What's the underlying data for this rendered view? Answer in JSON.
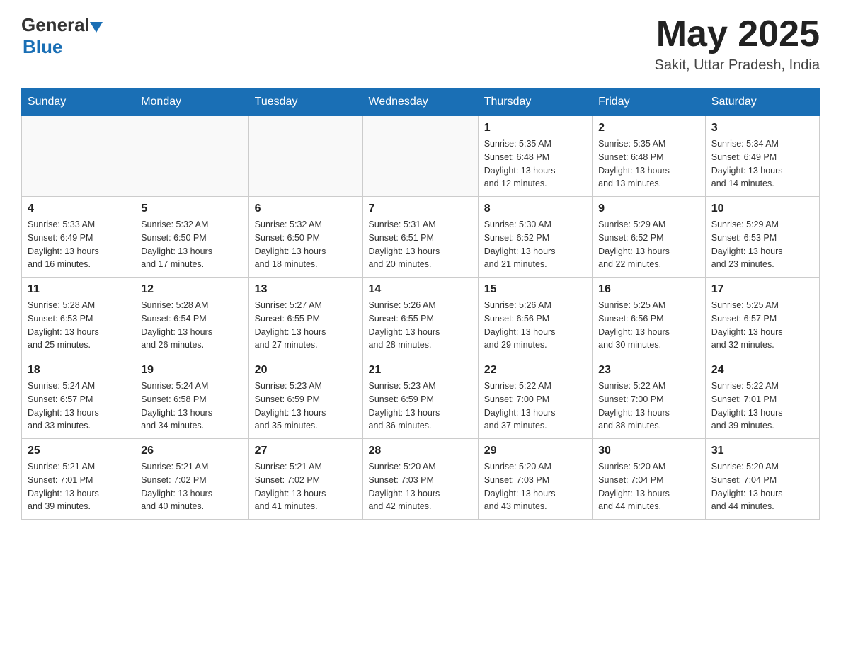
{
  "header": {
    "logo_general": "General",
    "logo_blue": "Blue",
    "month_year": "May 2025",
    "location": "Sakit, Uttar Pradesh, India"
  },
  "weekdays": [
    "Sunday",
    "Monday",
    "Tuesday",
    "Wednesday",
    "Thursday",
    "Friday",
    "Saturday"
  ],
  "weeks": [
    [
      {
        "day": "",
        "info": ""
      },
      {
        "day": "",
        "info": ""
      },
      {
        "day": "",
        "info": ""
      },
      {
        "day": "",
        "info": ""
      },
      {
        "day": "1",
        "info": "Sunrise: 5:35 AM\nSunset: 6:48 PM\nDaylight: 13 hours\nand 12 minutes."
      },
      {
        "day": "2",
        "info": "Sunrise: 5:35 AM\nSunset: 6:48 PM\nDaylight: 13 hours\nand 13 minutes."
      },
      {
        "day": "3",
        "info": "Sunrise: 5:34 AM\nSunset: 6:49 PM\nDaylight: 13 hours\nand 14 minutes."
      }
    ],
    [
      {
        "day": "4",
        "info": "Sunrise: 5:33 AM\nSunset: 6:49 PM\nDaylight: 13 hours\nand 16 minutes."
      },
      {
        "day": "5",
        "info": "Sunrise: 5:32 AM\nSunset: 6:50 PM\nDaylight: 13 hours\nand 17 minutes."
      },
      {
        "day": "6",
        "info": "Sunrise: 5:32 AM\nSunset: 6:50 PM\nDaylight: 13 hours\nand 18 minutes."
      },
      {
        "day": "7",
        "info": "Sunrise: 5:31 AM\nSunset: 6:51 PM\nDaylight: 13 hours\nand 20 minutes."
      },
      {
        "day": "8",
        "info": "Sunrise: 5:30 AM\nSunset: 6:52 PM\nDaylight: 13 hours\nand 21 minutes."
      },
      {
        "day": "9",
        "info": "Sunrise: 5:29 AM\nSunset: 6:52 PM\nDaylight: 13 hours\nand 22 minutes."
      },
      {
        "day": "10",
        "info": "Sunrise: 5:29 AM\nSunset: 6:53 PM\nDaylight: 13 hours\nand 23 minutes."
      }
    ],
    [
      {
        "day": "11",
        "info": "Sunrise: 5:28 AM\nSunset: 6:53 PM\nDaylight: 13 hours\nand 25 minutes."
      },
      {
        "day": "12",
        "info": "Sunrise: 5:28 AM\nSunset: 6:54 PM\nDaylight: 13 hours\nand 26 minutes."
      },
      {
        "day": "13",
        "info": "Sunrise: 5:27 AM\nSunset: 6:55 PM\nDaylight: 13 hours\nand 27 minutes."
      },
      {
        "day": "14",
        "info": "Sunrise: 5:26 AM\nSunset: 6:55 PM\nDaylight: 13 hours\nand 28 minutes."
      },
      {
        "day": "15",
        "info": "Sunrise: 5:26 AM\nSunset: 6:56 PM\nDaylight: 13 hours\nand 29 minutes."
      },
      {
        "day": "16",
        "info": "Sunrise: 5:25 AM\nSunset: 6:56 PM\nDaylight: 13 hours\nand 30 minutes."
      },
      {
        "day": "17",
        "info": "Sunrise: 5:25 AM\nSunset: 6:57 PM\nDaylight: 13 hours\nand 32 minutes."
      }
    ],
    [
      {
        "day": "18",
        "info": "Sunrise: 5:24 AM\nSunset: 6:57 PM\nDaylight: 13 hours\nand 33 minutes."
      },
      {
        "day": "19",
        "info": "Sunrise: 5:24 AM\nSunset: 6:58 PM\nDaylight: 13 hours\nand 34 minutes."
      },
      {
        "day": "20",
        "info": "Sunrise: 5:23 AM\nSunset: 6:59 PM\nDaylight: 13 hours\nand 35 minutes."
      },
      {
        "day": "21",
        "info": "Sunrise: 5:23 AM\nSunset: 6:59 PM\nDaylight: 13 hours\nand 36 minutes."
      },
      {
        "day": "22",
        "info": "Sunrise: 5:22 AM\nSunset: 7:00 PM\nDaylight: 13 hours\nand 37 minutes."
      },
      {
        "day": "23",
        "info": "Sunrise: 5:22 AM\nSunset: 7:00 PM\nDaylight: 13 hours\nand 38 minutes."
      },
      {
        "day": "24",
        "info": "Sunrise: 5:22 AM\nSunset: 7:01 PM\nDaylight: 13 hours\nand 39 minutes."
      }
    ],
    [
      {
        "day": "25",
        "info": "Sunrise: 5:21 AM\nSunset: 7:01 PM\nDaylight: 13 hours\nand 39 minutes."
      },
      {
        "day": "26",
        "info": "Sunrise: 5:21 AM\nSunset: 7:02 PM\nDaylight: 13 hours\nand 40 minutes."
      },
      {
        "day": "27",
        "info": "Sunrise: 5:21 AM\nSunset: 7:02 PM\nDaylight: 13 hours\nand 41 minutes."
      },
      {
        "day": "28",
        "info": "Sunrise: 5:20 AM\nSunset: 7:03 PM\nDaylight: 13 hours\nand 42 minutes."
      },
      {
        "day": "29",
        "info": "Sunrise: 5:20 AM\nSunset: 7:03 PM\nDaylight: 13 hours\nand 43 minutes."
      },
      {
        "day": "30",
        "info": "Sunrise: 5:20 AM\nSunset: 7:04 PM\nDaylight: 13 hours\nand 44 minutes."
      },
      {
        "day": "31",
        "info": "Sunrise: 5:20 AM\nSunset: 7:04 PM\nDaylight: 13 hours\nand 44 minutes."
      }
    ]
  ]
}
